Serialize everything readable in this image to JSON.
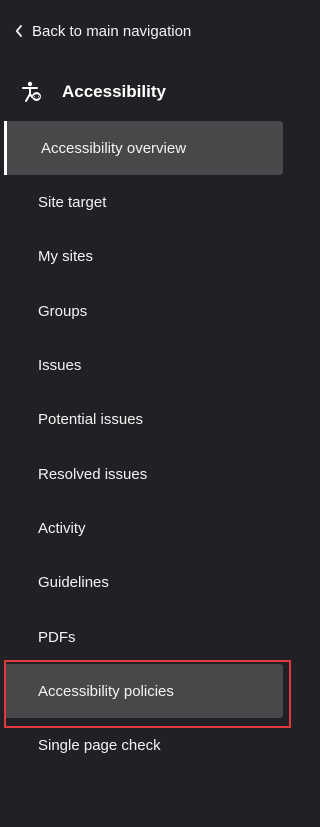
{
  "back": {
    "label": "Back to main navigation",
    "icon": "chevron-left-icon"
  },
  "section": {
    "title": "Accessibility",
    "icon": "accessibility-icon"
  },
  "nav": {
    "items": [
      {
        "label": "Accessibility overview",
        "state": "active"
      },
      {
        "label": "Site target"
      },
      {
        "label": "My sites"
      },
      {
        "label": "Groups"
      },
      {
        "label": "Issues"
      },
      {
        "label": "Potential issues"
      },
      {
        "label": "Resolved issues"
      },
      {
        "label": "Activity"
      },
      {
        "label": "Guidelines"
      },
      {
        "label": "PDFs"
      },
      {
        "label": "Accessibility policies",
        "state": "highlighted"
      },
      {
        "label": "Single page check"
      }
    ]
  },
  "colors": {
    "background": "#212125",
    "item_active_bg": "#48484b",
    "highlight_border": "#e0393e",
    "text": "#f2f2f2"
  }
}
